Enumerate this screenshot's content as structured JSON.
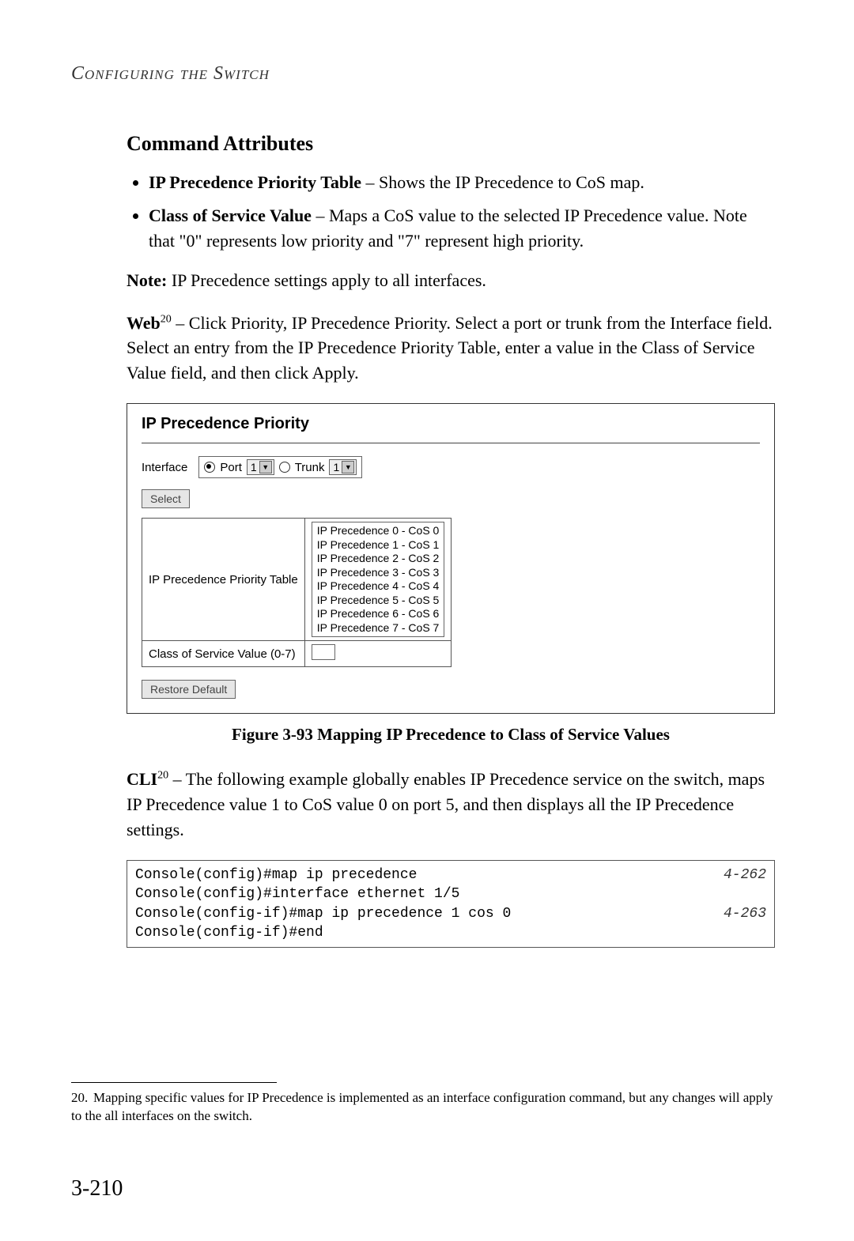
{
  "running_head": "Configuring the Switch",
  "section_title": "Command Attributes",
  "bullets": [
    {
      "label": "IP Precedence Priority Table",
      "sep": " – ",
      "text": "Shows the IP Precedence to CoS map."
    },
    {
      "label": "Class of Service Value",
      "sep": " – ",
      "text": "Maps a CoS value to the selected IP Precedence value. Note that \"0\" represents low priority and \"7\" represent high priority."
    }
  ],
  "note_label": "Note:",
  "note_text": " IP Precedence settings apply to all interfaces.",
  "web_label": "Web",
  "web_sup": "20",
  "web_text": " – Click Priority, IP Precedence Priority. Select a port or trunk from the Interface field. Select an entry from the IP Precedence Priority Table, enter a value in the Class of Service Value field, and then click Apply.",
  "figure": {
    "title": "IP Precedence Priority",
    "interface_label": "Interface",
    "port_label": "Port",
    "port_value": "1",
    "trunk_label": "Trunk",
    "trunk_value": "1",
    "select_btn": "Select",
    "table_label": "IP Precedence Priority Table",
    "list_items": [
      "IP Precedence 0 - CoS 0",
      "IP Precedence 1 - CoS 1",
      "IP Precedence 2 - CoS 2",
      "IP Precedence 3 - CoS 3",
      "IP Precedence 4 - CoS 4",
      "IP Precedence 5 - CoS 5",
      "IP Precedence 6 - CoS 6",
      "IP Precedence 7 - CoS 7"
    ],
    "cos_label": "Class of Service Value (0-7)",
    "restore_btn": "Restore Default"
  },
  "figure_caption": "Figure 3-93   Mapping IP Precedence to Class of Service Values",
  "cli_label": "CLI",
  "cli_sup": "20",
  "cli_text": " – The following example globally enables IP Precedence service on the switch, maps IP Precedence value 1 to CoS value 0 on port 5, and then displays all the IP Precedence settings.",
  "cli_lines": [
    {
      "cmd": "Console(config)#map ip precedence",
      "ref": "4-262"
    },
    {
      "cmd": "Console(config)#interface ethernet 1/5",
      "ref": ""
    },
    {
      "cmd": "Console(config-if)#map ip precedence 1 cos 0",
      "ref": "4-263"
    },
    {
      "cmd": "Console(config-if)#end",
      "ref": ""
    }
  ],
  "footnote_num": "20.",
  "footnote_text": "Mapping specific values for IP Precedence is implemented as an interface configuration command, but any changes will apply to the all interfaces on the switch.",
  "page_number": "3-210"
}
